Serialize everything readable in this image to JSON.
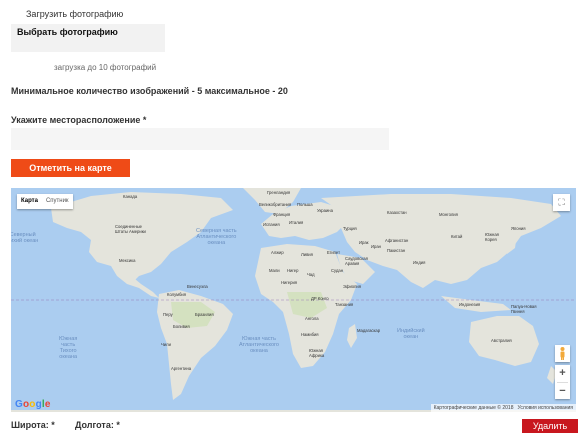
{
  "upload": {
    "title": "Загрузить фотографию",
    "choose_button": "Выбрать фотографию",
    "hint": "загрузка до 10 фотографий"
  },
  "images_rule": "Минимальное количество изображений - 5 максимальное - 20",
  "location": {
    "label": "Укажите месторасположение *",
    "value": "",
    "placeholder": ""
  },
  "mark_on_map_button": "Отметить на карте",
  "map": {
    "type_map": "Карта",
    "type_satellite": "Спутник",
    "fullscreen_icon": "fullscreen-icon",
    "pegman_icon": "pegman-icon",
    "zoom_in": "+",
    "zoom_out": "−",
    "attribution": "Картографические данные © 2018",
    "terms": "Условия использования",
    "colors": {
      "water": "#abcdf0",
      "land": "#e4e4dc",
      "park": "#c9dfae"
    },
    "oceans": {
      "north_atlantic": "Северная часть\nАтлантического\nокеана",
      "north_pacific": "Северный\nТихий океан",
      "south_pacific": "Южная\nчасть\nТихого\nокеана",
      "south_atlantic": "Южная часть\nАтлантического\nокеана",
      "indian": "Индийский\nокеан"
    },
    "places": {
      "greenland": "Гренландия",
      "canada": "Канада",
      "usa": "Соединенные\nШтаты Америки",
      "mexico": "Мексика",
      "venezuela": "Венесуэла",
      "colombia": "Колумбия",
      "peru": "Перу",
      "brazil": "Бразилия",
      "bolivia": "Боливия",
      "chile": "Чили",
      "argentina": "Аргентина",
      "uk": "Великобритания",
      "poland": "Польша",
      "france": "Франция",
      "ukraine": "Украина",
      "kazakhstan": "Казахстан",
      "mongolia": "Монголия",
      "spain": "Испания",
      "turkey": "Турция",
      "italy": "Италия",
      "china": "Китай",
      "japan": "Япония",
      "korea": "Южная\nКорея",
      "afghanistan": "Афганистан",
      "iraq": "Ирак",
      "iran": "Иран",
      "pakistan": "Пакистан",
      "algeria": "Алжир",
      "libya": "Ливия",
      "egypt": "Египет",
      "saudi": "Саудовская\nАравия",
      "india": "Индия",
      "mali": "Мали",
      "niger": "Нигер",
      "chad": "Чад",
      "sudan": "Судан",
      "nigeria": "Нигерия",
      "ethiopia": "Эфиопия",
      "drc": "ДР Конго",
      "tanzania": "Танзания",
      "angola": "Ангола",
      "madagascar": "Мадагаскар",
      "namibia": "Намибия",
      "south_africa": "Южная\nАфрика",
      "indonesia": "Индонезия",
      "papua": "Папуа-Новая\nГвинея",
      "australia": "Австралия"
    }
  },
  "latitude_label": "Широта: *",
  "longitude_label": "Долгота: *",
  "delete_button": "Удалить"
}
